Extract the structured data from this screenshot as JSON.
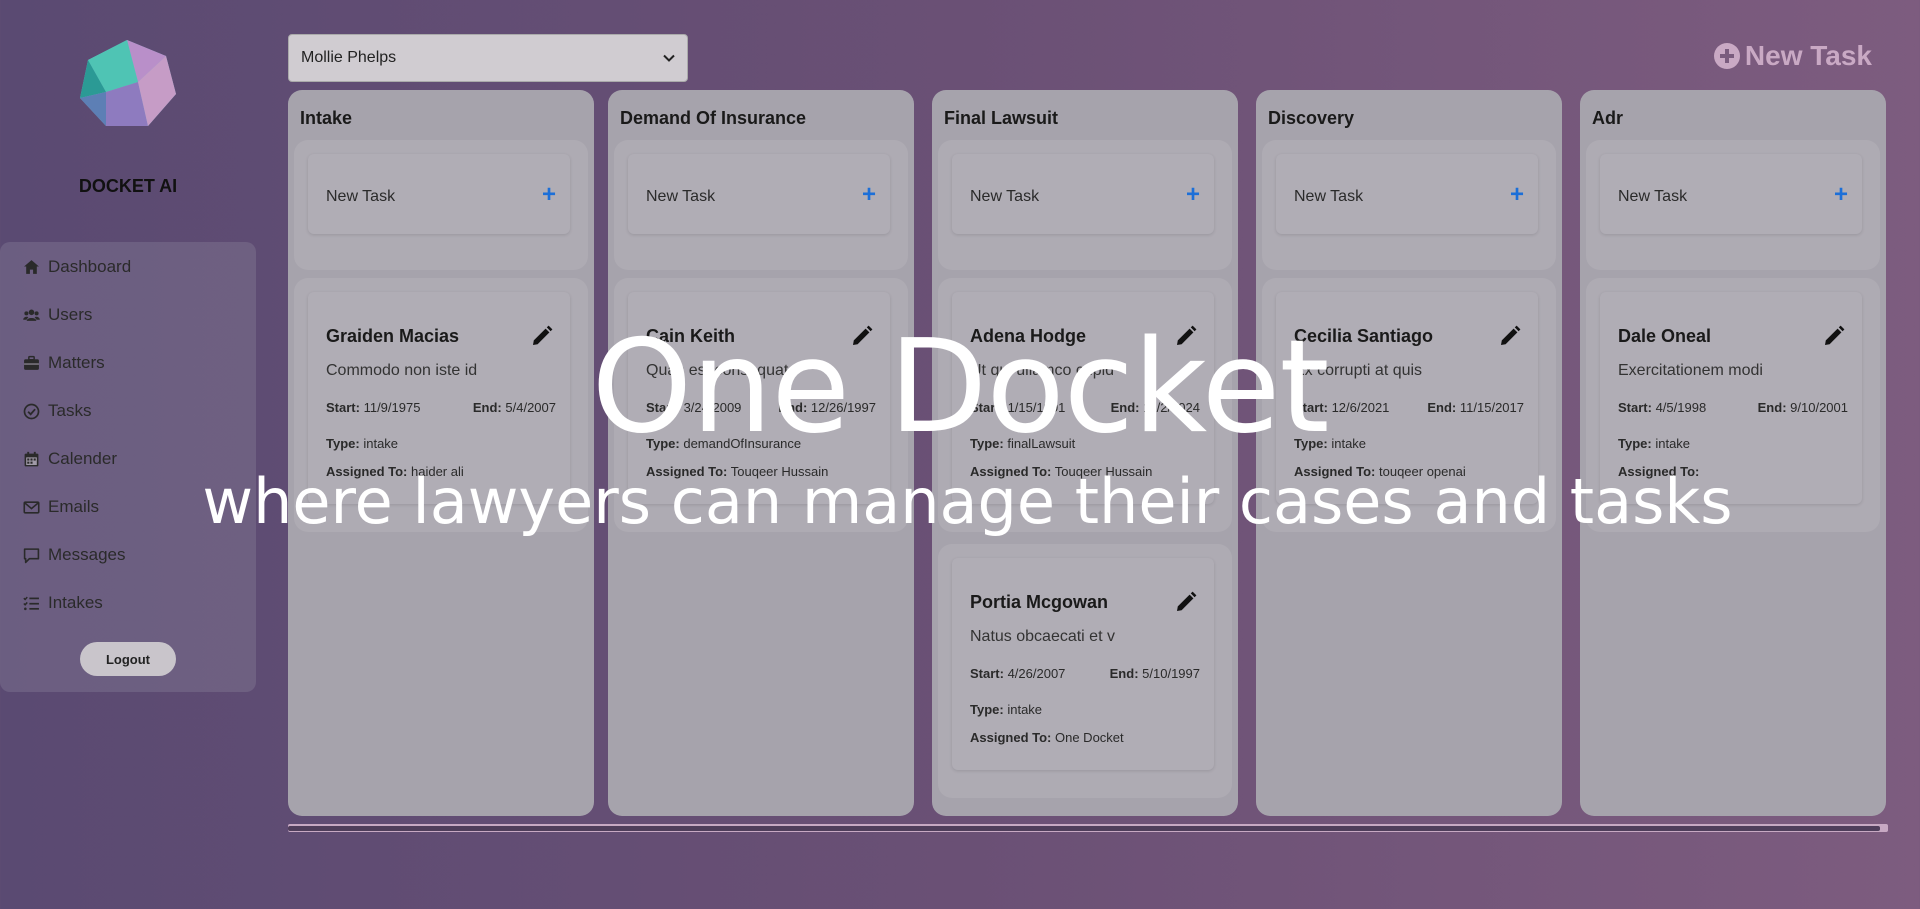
{
  "brand": {
    "name": "DOCKET AI"
  },
  "nav": {
    "items": [
      {
        "label": "Dashboard",
        "icon": "home-icon"
      },
      {
        "label": "Users",
        "icon": "users-icon"
      },
      {
        "label": "Matters",
        "icon": "briefcase-icon"
      },
      {
        "label": "Tasks",
        "icon": "check-circle-icon"
      },
      {
        "label": "Calender",
        "icon": "calendar-icon"
      },
      {
        "label": "Emails",
        "icon": "envelope-icon"
      },
      {
        "label": "Messages",
        "icon": "message-icon"
      },
      {
        "label": "Intakes",
        "icon": "list-check-icon"
      }
    ],
    "logout_label": "Logout"
  },
  "topbar": {
    "user_select_value": "Mollie Phelps",
    "new_task_label": "New Task"
  },
  "columns": [
    {
      "title": "Intake",
      "new_task_label": "New Task",
      "tasks": [
        {
          "name": "Graiden Macias",
          "desc": "Commodo non iste id",
          "start": "11/9/1975",
          "end": "5/4/2007",
          "type": "intake",
          "assigned": "haider ali"
        }
      ]
    },
    {
      "title": "Demand Of Insurance",
      "new_task_label": "New Task",
      "tasks": [
        {
          "name": "Cain Keith",
          "desc": "Quas est consequat",
          "start": "3/24/2009",
          "end": "12/26/1997",
          "type": "demandOfInsurance",
          "assigned": "Touqeer Hussain"
        }
      ]
    },
    {
      "title": "Final Lawsuit",
      "new_task_label": "New Task",
      "tasks": [
        {
          "name": "Adena Hodge",
          "desc": "Ut qui ullamco cupid",
          "start": "1/15/1991",
          "end": "11/2/2024",
          "type": "finalLawsuit",
          "assigned": "Touqeer Hussain"
        },
        {
          "name": "Portia Mcgowan",
          "desc": "Natus obcaecati et v",
          "start": "4/26/2007",
          "end": "5/10/1997",
          "type": "intake",
          "assigned": "One Docket"
        }
      ]
    },
    {
      "title": "Discovery",
      "new_task_label": "New Task",
      "tasks": [
        {
          "name": "Cecilia Santiago",
          "desc": "Ex corrupti at quis",
          "start": "12/6/2021",
          "end": "11/15/2017",
          "type": "intake",
          "assigned": "touqeer openai"
        }
      ]
    },
    {
      "title": "Adr",
      "new_task_label": "New Task",
      "tasks": [
        {
          "name": "Dale Oneal",
          "desc": "Exercitationem modi",
          "start": "4/5/1998",
          "end": "9/10/2001",
          "type": "intake",
          "assigned": ""
        }
      ]
    }
  ],
  "labels": {
    "start": "Start:",
    "end": "End:",
    "type": "Type:",
    "assigned": "Assigned To:"
  },
  "overlay": {
    "title": "One Docket",
    "subtitle": "where lawyers can manage their cases and tasks"
  },
  "colors": {
    "accent_blue": "#1c6fd8",
    "overlay_text": "#ffffff",
    "brand_purple": "#5a4a72"
  }
}
